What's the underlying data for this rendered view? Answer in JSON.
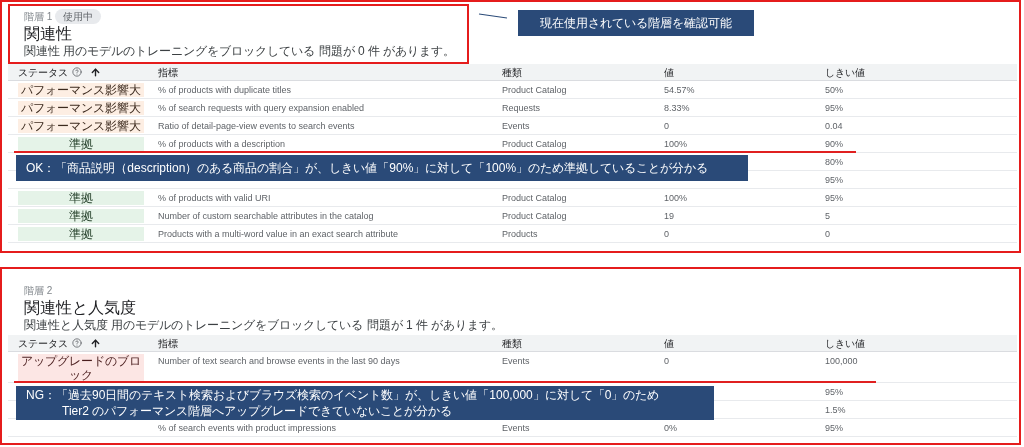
{
  "sections": [
    {
      "tier_label": "階層 1",
      "badge": "使用中",
      "title": "関連性",
      "description": "関連性 用のモデルのトレーニングをブロックしている 問題が 0 件 があります。",
      "header_highlighted": true,
      "header_callout": {
        "lines": [
          "現在使用されている階層を確認可能"
        ]
      },
      "columns": [
        {
          "label": "ステータス",
          "help": true,
          "sort_ascending": true
        },
        {
          "label": "指標"
        },
        {
          "label": "種類"
        },
        {
          "label": "値"
        },
        {
          "label": "しきい値"
        }
      ],
      "rows": [
        {
          "status": {
            "text": "パフォーマンス影響大",
            "kind": "warning"
          },
          "metric": "% of products with duplicate titles",
          "type": "Product Catalog",
          "value": "54.57%",
          "threshold": "50%",
          "underlined": false
        },
        {
          "status": {
            "text": "パフォーマンス影響大",
            "kind": "warning"
          },
          "metric": "% of search requests with query expansion enabled",
          "type": "Requests",
          "value": "8.33%",
          "threshold": "95%",
          "underlined": false
        },
        {
          "status": {
            "text": "パフォーマンス影響大",
            "kind": "warning"
          },
          "metric": "Ratio of detail-page-view events to search events",
          "type": "Events",
          "value": "0",
          "threshold": "0.04",
          "underlined": false
        },
        {
          "status": {
            "text": "準拠",
            "kind": "pass"
          },
          "metric": "% of products with a description",
          "type": "Product Catalog",
          "value": "100%",
          "threshold": "90%",
          "underlined": true
        },
        {
          "threshold": "80%",
          "underlined": false
        },
        {
          "threshold": "95%",
          "underlined": false
        },
        {
          "status": {
            "text": "準拠",
            "kind": "pass"
          },
          "metric": "% of products with valid URI",
          "type": "Product Catalog",
          "value": "100%",
          "threshold": "95%",
          "underlined": false
        },
        {
          "status": {
            "text": "準拠",
            "kind": "pass"
          },
          "metric": "Number of custom searchable attributes in the catalog",
          "type": "Product Catalog",
          "value": "19",
          "threshold": "5",
          "underlined": false
        },
        {
          "status": {
            "text": "準拠",
            "kind": "pass"
          },
          "metric": "Products with a multi-word value in an exact search attribute",
          "type": "Products",
          "value": "0",
          "threshold": "0",
          "underlined": false
        }
      ],
      "row_callout": {
        "lines": [
          "OK：「商品説明（description）のある商品の割合」が、しきい値「90%」に対して「100%」のため準拠していることが分かる"
        ]
      }
    },
    {
      "tier_label": "階層 2",
      "title": "関連性と人気度",
      "description": "関連性と人気度 用のモデルのトレーニングをブロックしている 問題が 1 件 があります。",
      "header_highlighted": false,
      "columns": [
        {
          "label": "ステータス",
          "help": true,
          "sort_ascending": true
        },
        {
          "label": "指標"
        },
        {
          "label": "種類"
        },
        {
          "label": "値"
        },
        {
          "label": "しきい値"
        }
      ],
      "rows": [
        {
          "status": {
            "text": "アップグレードのブロック",
            "kind": "blocked"
          },
          "metric": "Number of text search and browse events in the last 90 days",
          "type": "Events",
          "value": "0",
          "threshold": "100,000",
          "underlined": true
        },
        {
          "threshold": "95%",
          "underlined": false
        },
        {
          "threshold": "1.5%",
          "underlined": false
        },
        {
          "metric": "% of search events with product impressions",
          "type": "Events",
          "value": "0%",
          "threshold": "95%",
          "underlined": false
        }
      ],
      "row_callout": {
        "lines": [
          "NG：「過去90日間のテキスト検索およびブラウズ検索のイベント数」が、しきい値「100,000」に対して「0」のため",
          "Tier2 のパフォーマンス階層へアップグレードできていないことが分かる"
        ]
      }
    }
  ]
}
